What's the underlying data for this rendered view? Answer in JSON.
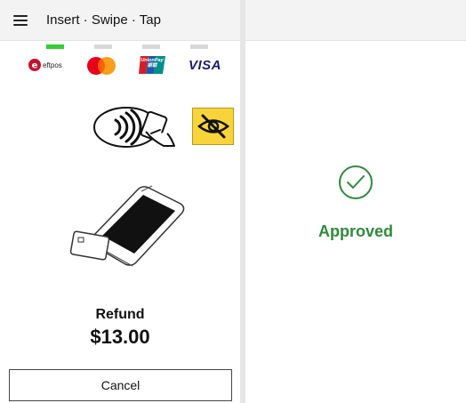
{
  "left_panel": {
    "header": {
      "title": "Insert · Swipe · Tap",
      "menu_icon": "hamburger-menu-icon"
    },
    "indicators": {
      "count": 4,
      "active_index": 0,
      "active_color": "#33cc33",
      "inactive_color": "#d8d8d8"
    },
    "payment_brands": [
      "eftpos",
      "mastercard",
      "UnionPay 银联",
      "VISA"
    ],
    "eftpos_label": "eftpos",
    "unionpay_label_top": "UnionPay",
    "unionpay_label_bottom": "银联",
    "visa_label": "VISA",
    "accessibility_icon": "eye-slash-icon",
    "accessibility_color": "#f8d43a",
    "transaction": {
      "type": "Refund",
      "amount": "$13.00"
    },
    "cancel_label": "Cancel"
  },
  "right_panel": {
    "status_text": "Approved",
    "status_icon": "check-circle-icon",
    "status_color": "#2e8b3a"
  }
}
